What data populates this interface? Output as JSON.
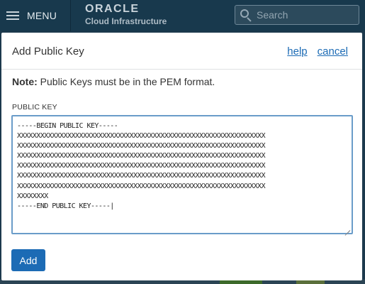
{
  "topbar": {
    "menu_label": "MENU",
    "brand_name": "ORACLE",
    "brand_sub": "Cloud Infrastructure",
    "search_placeholder": "Search"
  },
  "dialog": {
    "title": "Add Public Key",
    "help_link": "help",
    "cancel_link": "cancel",
    "note_label": "Note:",
    "note_text": " Public Keys must be in the PEM format.",
    "field_label": "PUBLIC KEY",
    "key_value": "-----BEGIN PUBLIC KEY-----\nXXXXXXXXXXXXXXXXXXXXXXXXXXXXXXXXXXXXXXXXXXXXXXXXXXXXXXXXXXXXXXXX\nXXXXXXXXXXXXXXXXXXXXXXXXXXXXXXXXXXXXXXXXXXXXXXXXXXXXXXXXXXXXXXXX\nXXXXXXXXXXXXXXXXXXXXXXXXXXXXXXXXXXXXXXXXXXXXXXXXXXXXXXXXXXXXXXXX\nXXXXXXXXXXXXXXXXXXXXXXXXXXXXXXXXXXXXXXXXXXXXXXXXXXXXXXXXXXXXXXXX\nXXXXXXXXXXXXXXXXXXXXXXXXXXXXXXXXXXXXXXXXXXXXXXXXXXXXXXXXXXXXXXXX\nXXXXXXXXXXXXXXXXXXXXXXXXXXXXXXXXXXXXXXXXXXXXXXXXXXXXXXXXXXXXXXXX\nXXXXXXXX\n-----END PUBLIC KEY-----|",
    "add_button": "Add"
  },
  "colors": {
    "topbar_bg": "#18394d",
    "accent": "#1c6bb5",
    "textarea_border": "#6a9cc9"
  },
  "icons": [
    "hamburger-icon",
    "search-icon",
    "resize-grip-icon"
  ]
}
